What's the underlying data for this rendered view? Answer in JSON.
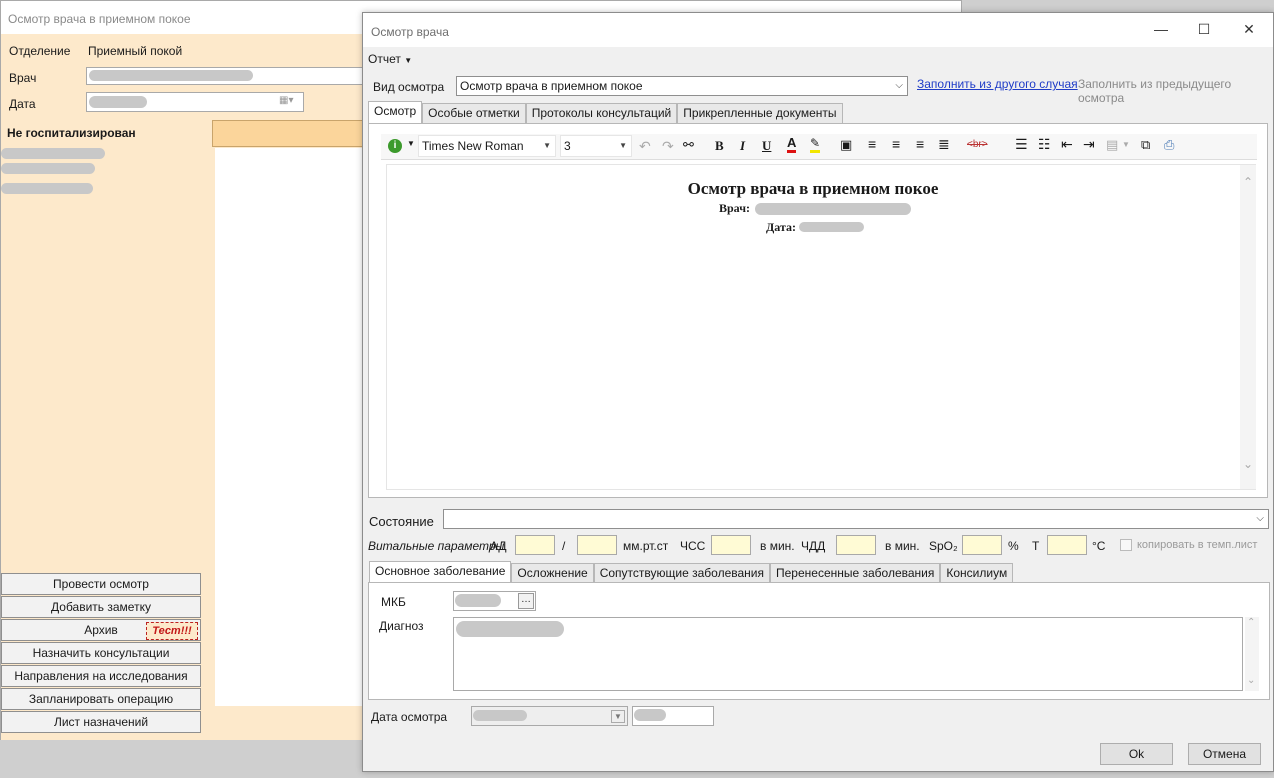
{
  "background_window": {
    "title": "Осмотр врача в приемном покое",
    "department_label": "Отделение",
    "department_value": "Приемный покой",
    "doctor_label": "Врач",
    "date_label": "Дата",
    "status": "Не госпитализирован",
    "buttons": [
      "Провести осмотр",
      "Добавить заметку",
      "Архив",
      "Назначить консультации",
      "Направления на исследования",
      "Запланировать операцию",
      "Лист назначений"
    ],
    "test_badge": "Тест!!!"
  },
  "dialog": {
    "title": "Осмотр врача",
    "menu_report": "Отчет",
    "exam_type_label": "Вид осмотра",
    "exam_type_value": "Осмотр врача в приемном покое",
    "fill_other_link": "Заполнить из другого случая",
    "fill_prev_link": "Заполнить из предыдущего осмотра",
    "tabs": [
      "Осмотр",
      "Особые отметки",
      "Протоколы консультаций",
      "Прикрепленные документы"
    ],
    "toolbar": {
      "font": "Times New Roman",
      "size": "3"
    },
    "doc": {
      "heading": "Осмотр врача в приемном покое",
      "doctor_label": "Врач:",
      "date_label": "Дата:"
    },
    "state_label": "Состояние",
    "vitals": {
      "label": "Витальные параметры",
      "ad": "АД",
      "slash": "/",
      "mmhg": "мм.рт.ст",
      "hr": "ЧСС",
      "per_min1": "в мин.",
      "rr": "ЧДД",
      "per_min2": "в мин.",
      "spo2": "SpO₂",
      "percent": "%",
      "t": "Т",
      "celsius": "°C",
      "copy_label": "копировать в темп.лист"
    },
    "diag_tabs": [
      "Основное заболевание",
      "Осложнение",
      "Сопутствующие заболевания",
      "Перенесенные заболевания",
      "Консилиум"
    ],
    "mkb_label": "МКБ",
    "diagnosis_label": "Диагноз",
    "exam_date_label": "Дата осмотра",
    "ok": "Ok",
    "cancel": "Отмена"
  }
}
